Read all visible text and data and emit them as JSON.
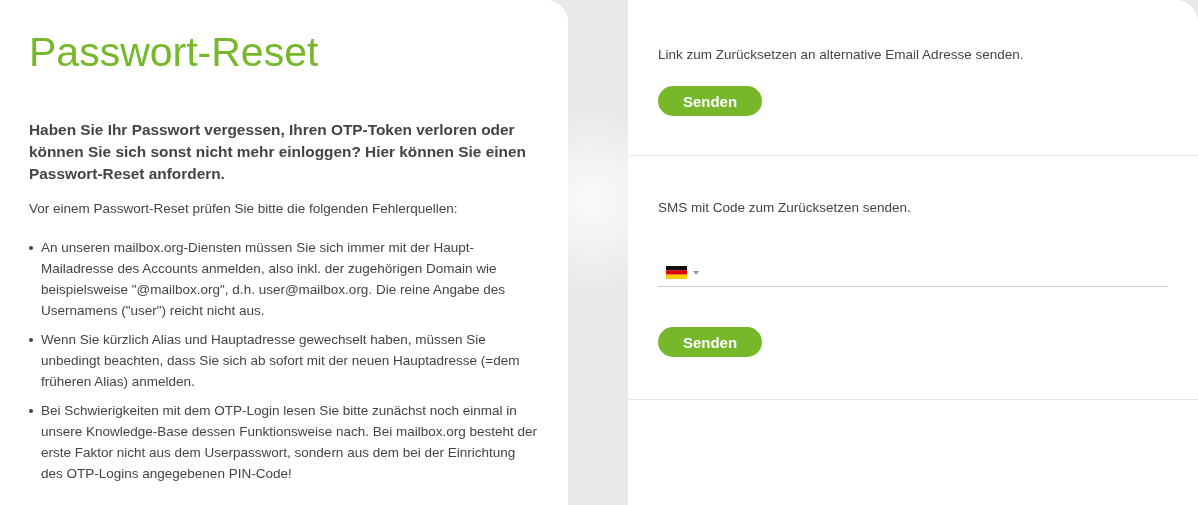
{
  "reset_info": {
    "title": "Passwort-Reset",
    "intro": "Haben Sie Ihr Passwort vergessen, Ihren OTP-Token verloren oder können Sie sich sonst nicht mehr einloggen? Hier können Sie einen Passwort-Reset anfordern.",
    "lead": "Vor einem Passwort-Reset prüfen Sie bitte die folgenden Fehlerquellen:",
    "bullets": [
      "An unseren mailbox.org-Diensten müssen Sie sich immer mit der Haupt-Mailadresse des Accounts anmelden, also inkl. der zugehörigen Domain wie beispielsweise \"@mailbox.org\", d.h. user@mailbox.org. Die reine Angabe des Usernamens (\"user\") reicht nicht aus.",
      "Wenn Sie kürzlich Alias und Hauptadresse gewechselt haben, müssen Sie unbedingt beachten, dass Sie sich ab sofort mit der neuen Hauptadresse (=dem früheren Alias) anmelden.",
      "Bei Schwierigkeiten mit dem OTP-Login lesen Sie bitte zunächst noch einmal in unsere Knowledge-Base dessen Funktionsweise nach. Bei mailbox.org besteht der erste Faktor nicht aus dem Userpasswort, sondern aus dem bei der Einrichtung des OTP-Logins angegebenen PIN-Code!"
    ]
  },
  "reset_options": [
    {
      "kind": "email",
      "description": "Link zum Zurücksetzen an alternative Email Adresse senden.",
      "button": "Senden"
    },
    {
      "kind": "sms",
      "description": "SMS mit Code zum Zurücksetzen senden.",
      "button": "Senden"
    }
  ]
}
